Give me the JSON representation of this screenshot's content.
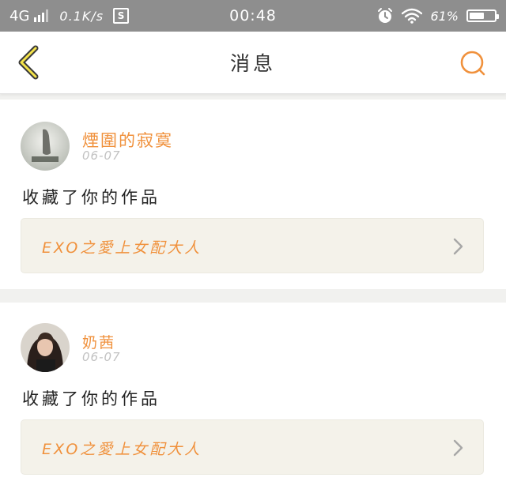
{
  "status_bar": {
    "network": "4G",
    "speed": "0.1K/s",
    "s_badge": "S",
    "time": "00:48",
    "battery": "61%",
    "battery_level": 0.61,
    "icons": [
      "signal-icon",
      "s-badge-icon",
      "alarm-icon",
      "wifi-icon",
      "battery-icon"
    ]
  },
  "header": {
    "title": "消息",
    "back_icon": "chevron-left-icon",
    "search_icon": "search-icon",
    "accent": "#f0913c"
  },
  "messages": [
    {
      "username": "煙圍的寂寞",
      "date": "06-07",
      "action": "收藏了你的作品",
      "work_title": "EXO之愛上女配大人"
    },
    {
      "username": "奶茜",
      "date": "06-07",
      "action": "收藏了你的作品",
      "work_title": "EXO之愛上女配大人"
    }
  ],
  "colors": {
    "accent": "#f0913c",
    "status_bar_bg": "#8e8e8e",
    "page_bg": "#f1f1ef",
    "link_bg": "#f4f2ea"
  }
}
